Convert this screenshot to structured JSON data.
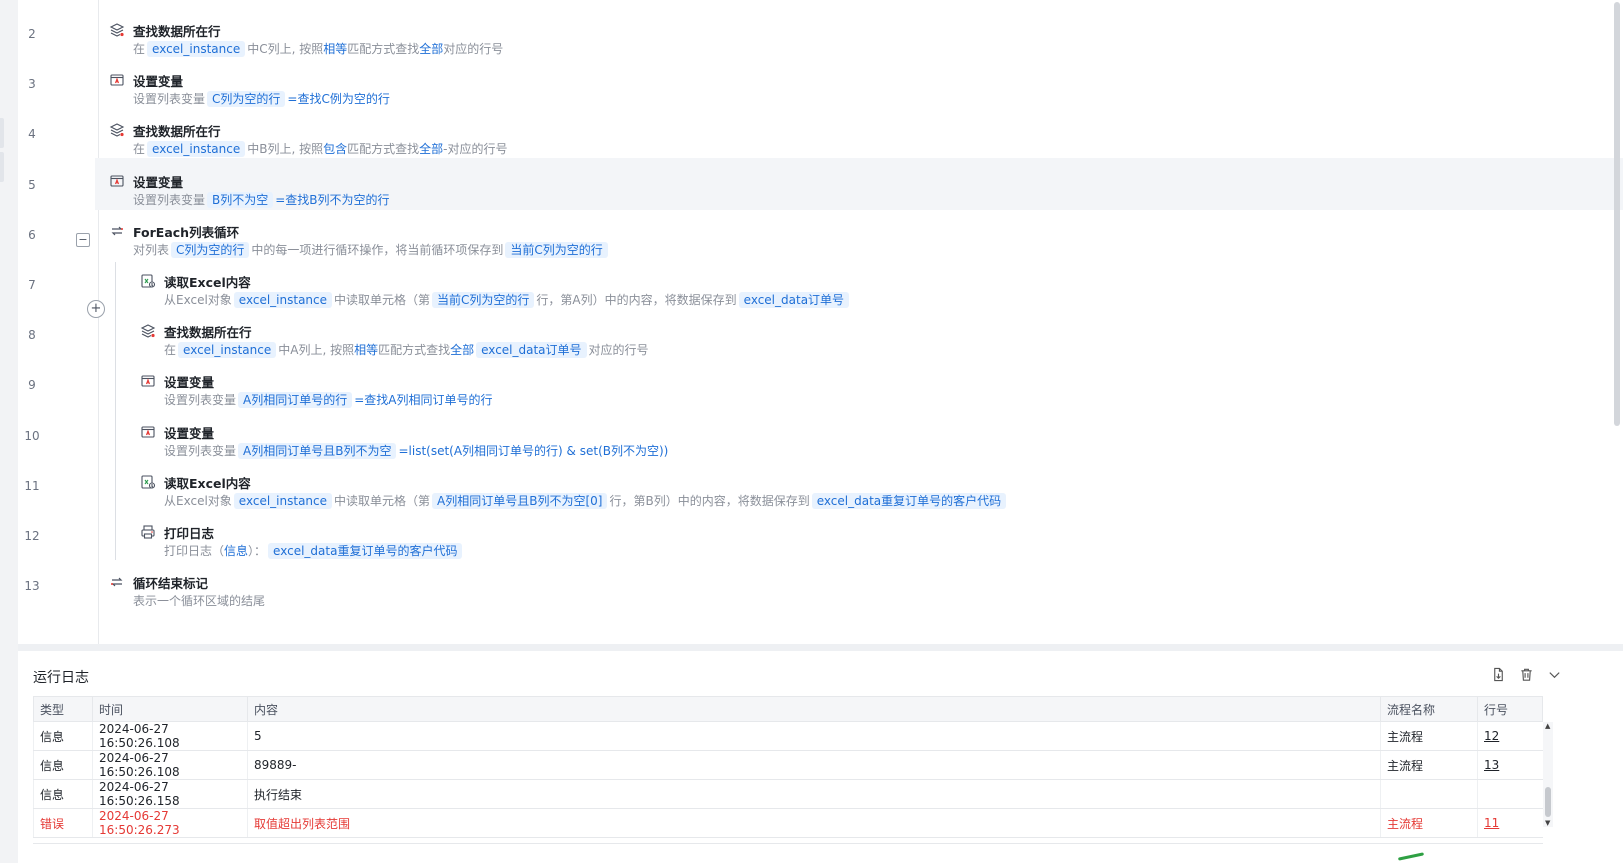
{
  "steps": [
    {
      "line": "2",
      "icon": "find-row-icon",
      "title": "查找数据所在行",
      "indent": 0,
      "desc": [
        {
          "t": "在",
          "c": "n"
        },
        {
          "t": "excel_instance",
          "c": "v"
        },
        {
          "t": "中C列上, 按照",
          "c": "n"
        },
        {
          "t": "相等",
          "c": "k"
        },
        {
          "t": "匹配方式查找",
          "c": "n"
        },
        {
          "t": "全部",
          "c": "k"
        },
        {
          "t": "对应的行号",
          "c": "n"
        }
      ]
    },
    {
      "line": "3",
      "icon": "set-variable-icon",
      "title": "设置变量",
      "indent": 0,
      "desc": [
        {
          "t": "设置列表变量",
          "c": "n"
        },
        {
          "t": "C列为空的行",
          "c": "v"
        },
        {
          "t": "=查找C例为空的行",
          "c": "x"
        }
      ]
    },
    {
      "line": "4",
      "icon": "find-row-icon",
      "title": "查找数据所在行",
      "indent": 0,
      "desc": [
        {
          "t": "在",
          "c": "n"
        },
        {
          "t": "excel_instance",
          "c": "v"
        },
        {
          "t": "中B列上, 按照",
          "c": "n"
        },
        {
          "t": "包含",
          "c": "k"
        },
        {
          "t": "匹配方式查找",
          "c": "n"
        },
        {
          "t": "全部",
          "c": "k"
        },
        {
          "t": "-对应的行号",
          "c": "n"
        }
      ]
    },
    {
      "line": "5",
      "icon": "set-variable-icon",
      "title": "设置变量",
      "indent": 0,
      "highlight": true,
      "desc": [
        {
          "t": "设置列表变量",
          "c": "n"
        },
        {
          "t": "B列不为空",
          "c": "v"
        },
        {
          "t": "=查找B列不为空的行",
          "c": "x"
        }
      ]
    },
    {
      "line": "6",
      "icon": "loop-icon",
      "title": "ForEach列表循环",
      "indent": 0,
      "desc": [
        {
          "t": "对列表",
          "c": "n"
        },
        {
          "t": "C列为空的行",
          "c": "v"
        },
        {
          "t": "中的每一项进行循环操作，将当前循环项保存到",
          "c": "n"
        },
        {
          "t": "当前C列为空的行",
          "c": "v"
        }
      ]
    },
    {
      "line": "7",
      "icon": "read-excel-icon",
      "title": "读取Excel内容",
      "indent": 1,
      "desc": [
        {
          "t": "从Excel对象",
          "c": "n"
        },
        {
          "t": "excel_instance",
          "c": "v"
        },
        {
          "t": "中读取单元格（第",
          "c": "n"
        },
        {
          "t": "当前C列为空的行",
          "c": "v"
        },
        {
          "t": "行，第A列）中的内容，将数据保存到",
          "c": "n"
        },
        {
          "t": "excel_data订单号",
          "c": "v"
        }
      ]
    },
    {
      "line": "8",
      "icon": "find-row-icon",
      "title": "查找数据所在行",
      "indent": 1,
      "desc": [
        {
          "t": "在",
          "c": "n"
        },
        {
          "t": "excel_instance",
          "c": "v"
        },
        {
          "t": "中A列上, 按照",
          "c": "n"
        },
        {
          "t": "相等",
          "c": "k"
        },
        {
          "t": "匹配方式查找",
          "c": "n"
        },
        {
          "t": "全部",
          "c": "k"
        },
        {
          "t": "excel_data订单号",
          "c": "v"
        },
        {
          "t": "对应的行号",
          "c": "n"
        }
      ]
    },
    {
      "line": "9",
      "icon": "set-variable-icon",
      "title": "设置变量",
      "indent": 1,
      "desc": [
        {
          "t": "设置列表变量",
          "c": "n"
        },
        {
          "t": "A列相同订单号的行",
          "c": "v"
        },
        {
          "t": "=查找A列相同订单号的行",
          "c": "x"
        }
      ]
    },
    {
      "line": "10",
      "icon": "set-variable-icon",
      "title": "设置变量",
      "indent": 1,
      "desc": [
        {
          "t": "设置列表变量",
          "c": "n"
        },
        {
          "t": "A列相同订单号且B列不为空",
          "c": "v"
        },
        {
          "t": "=list(set(A列相同订单号的行) & set(B列不为空))",
          "c": "x"
        }
      ]
    },
    {
      "line": "11",
      "icon": "read-excel-icon",
      "title": "读取Excel内容",
      "indent": 1,
      "desc": [
        {
          "t": "从Excel对象",
          "c": "n"
        },
        {
          "t": "excel_instance",
          "c": "v"
        },
        {
          "t": "中读取单元格（第",
          "c": "n"
        },
        {
          "t": "A列相同订单号且B列不为空[0]",
          "c": "v"
        },
        {
          "t": "行，第B列）中的内容，将数据保存到",
          "c": "n"
        },
        {
          "t": "excel_data重复订单号的客户代码",
          "c": "v"
        }
      ]
    },
    {
      "line": "12",
      "icon": "print-log-icon",
      "title": "打印日志",
      "indent": 1,
      "desc": [
        {
          "t": "打印日志（",
          "c": "n"
        },
        {
          "t": "信息",
          "c": "k"
        },
        {
          "t": "）：",
          "c": "n"
        },
        {
          "t": "excel_data重复订单号的客户代码",
          "c": "v"
        }
      ]
    },
    {
      "line": "13",
      "icon": "loop-end-icon",
      "title": "循环结束标记",
      "indent": 0,
      "desc": [
        {
          "t": "表示一个循环区域的结尾",
          "c": "n"
        }
      ]
    }
  ],
  "editor": {
    "collapse_glyph": "−",
    "add_glyph": "+"
  },
  "log": {
    "title": "运行日志",
    "columns": [
      "类型",
      "时间",
      "内容",
      "流程名称",
      "行号"
    ],
    "rows": [
      {
        "type": "信息",
        "time": "2024-06-27 16:50:26.108",
        "content": "5",
        "flow": "主流程",
        "line": "12",
        "error": false
      },
      {
        "type": "信息",
        "time": "2024-06-27 16:50:26.108",
        "content": "89889-",
        "flow": "主流程",
        "line": "13",
        "error": false
      },
      {
        "type": "信息",
        "time": "2024-06-27 16:50:26.158",
        "content": "执行结束",
        "flow": "",
        "line": "",
        "error": false
      },
      {
        "type": "错误",
        "time": "2024-06-27 16:50:26.273",
        "content": "取值超出列表范围",
        "flow": "主流程",
        "line": "11",
        "error": true
      }
    ],
    "tools": [
      "export-icon",
      "trash-icon",
      "chevron-down-icon"
    ],
    "colors": {
      "error": "#e53935",
      "token_bg": "#e8f2fe",
      "token_fg": "#1f6fd6"
    }
  }
}
